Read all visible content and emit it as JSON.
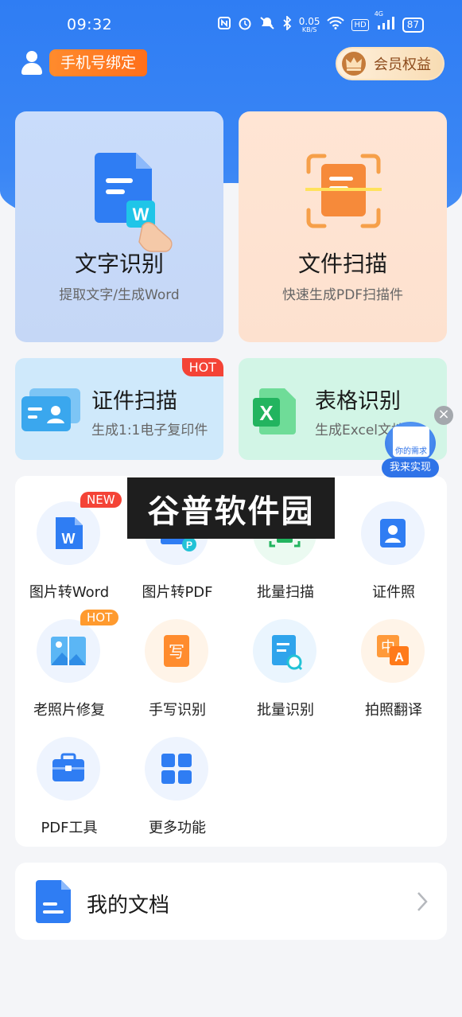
{
  "status_bar": {
    "time": "09:32",
    "speed_value": "0.05",
    "speed_unit": "KB/S",
    "network": "4G",
    "hd": "HD",
    "battery": "87"
  },
  "header": {
    "bind_phone_label": "手机号绑定",
    "vip_label": "会员权益"
  },
  "cards": {
    "word": {
      "title": "文字识别",
      "subtitle": "提取文字/生成Word"
    },
    "scan": {
      "title": "文件扫描",
      "subtitle": "快速生成PDF扫描件"
    },
    "id": {
      "title": "证件扫描",
      "subtitle": "生成1:1电子复印件",
      "badge": "HOT"
    },
    "table": {
      "title": "表格识别",
      "subtitle": "生成Excel文档"
    }
  },
  "watermark": "谷普软件园",
  "tools": [
    {
      "label": "图片转Word",
      "badge": "NEW",
      "icon": "word-doc-icon"
    },
    {
      "label": "图片转PDF",
      "icon": "pdf-image-icon"
    },
    {
      "label": "批量扫描",
      "icon": "batch-scan-icon"
    },
    {
      "label": "证件照",
      "icon": "id-photo-icon"
    },
    {
      "label": "老照片修复",
      "badge": "HOT",
      "icon": "photo-restore-icon"
    },
    {
      "label": "手写识别",
      "icon": "handwriting-icon"
    },
    {
      "label": "批量识别",
      "icon": "batch-recognize-icon"
    },
    {
      "label": "拍照翻译",
      "icon": "translate-icon"
    },
    {
      "label": "PDF工具",
      "icon": "toolbox-icon"
    },
    {
      "label": "更多功能",
      "icon": "grid-icon"
    }
  ],
  "my_docs": {
    "label": "我的文档"
  },
  "float_widget": {
    "note": "你的需求",
    "cta": "我来实现"
  },
  "colors": {
    "primary_blue": "#2f7df3",
    "orange": "#ff7a22",
    "hot_red": "#f44336"
  }
}
